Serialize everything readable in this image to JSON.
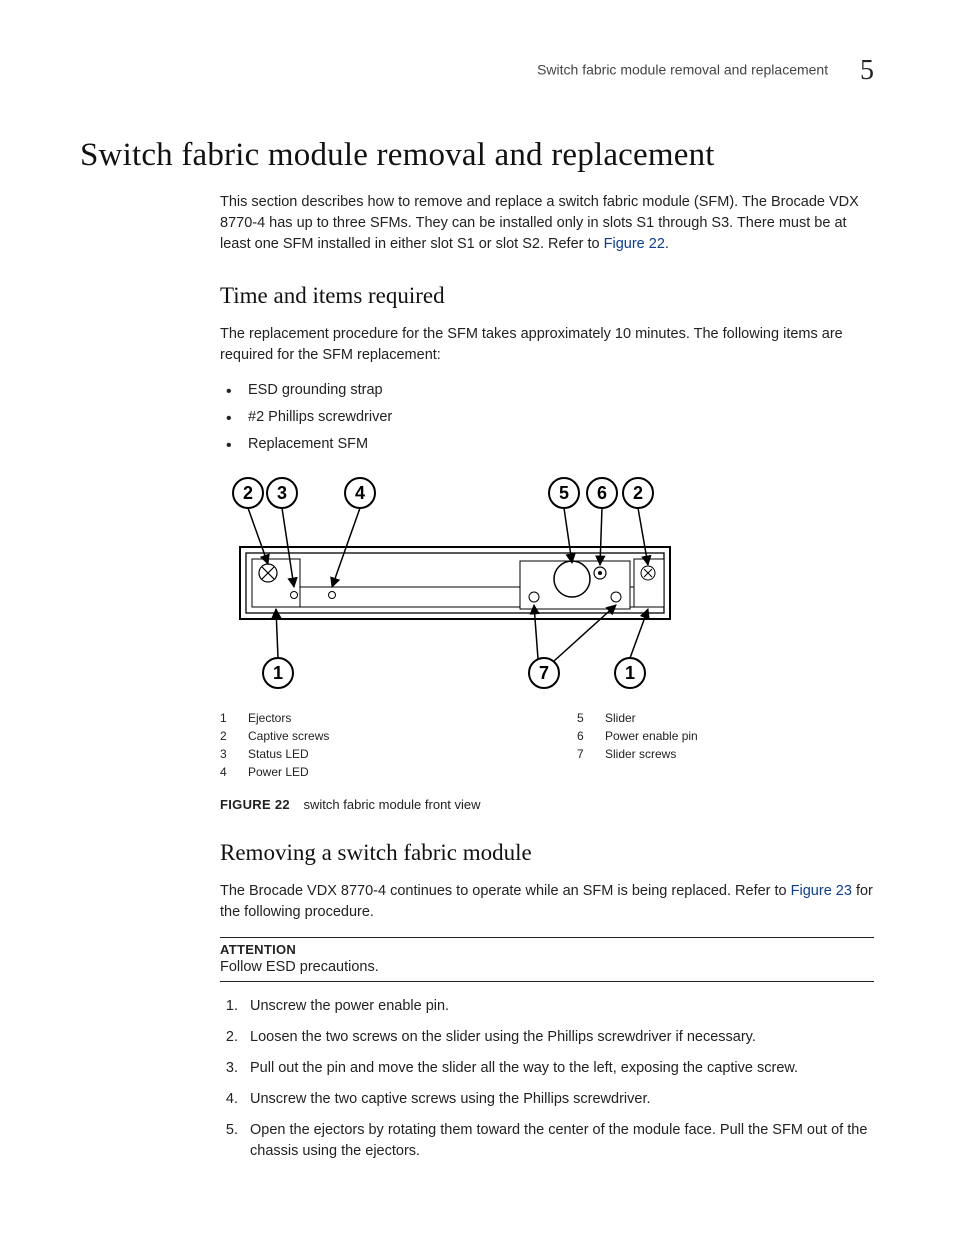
{
  "header": {
    "running_title": "Switch fabric module removal and replacement",
    "chapter_number": "5"
  },
  "title": "Switch fabric module removal and replacement",
  "intro": {
    "text_before_link": "This section describes how to remove and replace a switch fabric module (SFM). The Brocade VDX 8770-4 has up to three SFMs. They can be installed only in slots S1 through S3. There must be at least one SFM installed in either slot S1 or slot S2. Refer to ",
    "link_text": "Figure 22",
    "text_after_link": "."
  },
  "time_items": {
    "heading": "Time and items required",
    "para": "The replacement procedure for the SFM takes approximately 10 minutes. The following items are required for the SFM replacement:",
    "bullets": [
      "ESD grounding strap",
      "#2 Phillips screwdriver",
      "Replacement SFM"
    ]
  },
  "figure": {
    "callouts_top": [
      "2",
      "3",
      "4",
      "5",
      "6",
      "2"
    ],
    "callouts_bottom": [
      "1",
      "7",
      "1"
    ],
    "legend_left": [
      {
        "n": "1",
        "t": "Ejectors"
      },
      {
        "n": "2",
        "t": "Captive screws"
      },
      {
        "n": "3",
        "t": "Status LED"
      },
      {
        "n": "4",
        "t": "Power LED"
      }
    ],
    "legend_right": [
      {
        "n": "5",
        "t": "Slider"
      },
      {
        "n": "6",
        "t": "Power enable pin"
      },
      {
        "n": "7",
        "t": "Slider screws"
      }
    ],
    "caption_label": "FIGURE 22",
    "caption_text": "switch fabric module front view"
  },
  "removing": {
    "heading": "Removing a switch fabric module",
    "para_before_link": "The Brocade VDX 8770-4 continues to operate while an SFM is being replaced. Refer to ",
    "link_text": "Figure 23",
    "para_after_link": " for the following procedure.",
    "attention_label": "ATTENTION",
    "attention_text": "Follow ESD precautions.",
    "steps": [
      "Unscrew the power enable pin.",
      "Loosen the two screws on the slider using the Phillips screwdriver if necessary.",
      "Pull out the pin and move the slider all the way to the left, exposing the captive screw.",
      "Unscrew the two captive screws using the Phillips screwdriver.",
      "Open the ejectors by rotating them toward the center of the module face. Pull the SFM out of the chassis using the ejectors."
    ]
  }
}
